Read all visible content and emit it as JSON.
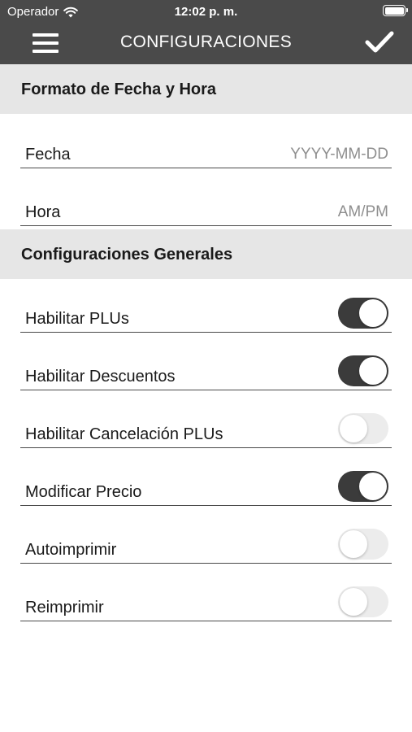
{
  "status_bar": {
    "carrier": "Operador",
    "time": "12:02 p. m."
  },
  "navbar": {
    "title": "CONFIGURACIONES",
    "menu_icon": "hamburger-menu-icon",
    "confirm_icon": "checkmark-icon"
  },
  "sections": [
    {
      "title": "Formato de Fecha y Hora",
      "rows": [
        {
          "label": "Fecha",
          "value": "YYYY-MM-DD"
        },
        {
          "label": "Hora",
          "value": "AM/PM"
        }
      ]
    },
    {
      "title": "Configuraciones Generales",
      "toggles": [
        {
          "label": "Habilitar PLUs",
          "on": true
        },
        {
          "label": "Habilitar Descuentos",
          "on": true
        },
        {
          "label": "Habilitar Cancelación PLUs",
          "on": false
        },
        {
          "label": "Modificar Precio",
          "on": true
        },
        {
          "label": "Autoimprimir",
          "on": false
        },
        {
          "label": "Reimprimir",
          "on": false
        }
      ]
    }
  ],
  "colors": {
    "navbar_bg": "#4a4a4a",
    "section_bg": "#e6e6e6",
    "toggle_on": "#3b3b3b",
    "toggle_off": "#ececec"
  }
}
